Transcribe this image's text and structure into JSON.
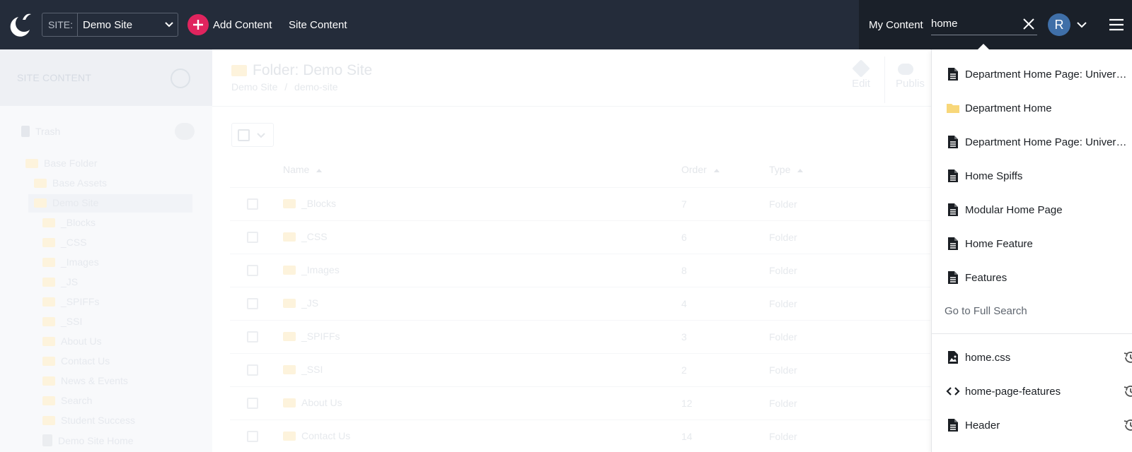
{
  "header": {
    "site_label": "SITE:",
    "site_value": "Demo Site",
    "add_content": "Add Content",
    "site_content": "Site Content",
    "my_content": "My Content",
    "search_value": "home",
    "avatar_initial": "R"
  },
  "sidebar": {
    "title": "SITE CONTENT",
    "trash": "Trash",
    "tree": [
      {
        "label": "Base Folder",
        "kind": "folder"
      },
      {
        "label": "Base Assets",
        "kind": "folder"
      },
      {
        "label": "Demo Site",
        "kind": "folder"
      },
      {
        "label": "_Blocks",
        "kind": "folder"
      },
      {
        "label": "_CSS",
        "kind": "folder"
      },
      {
        "label": "_Images",
        "kind": "folder"
      },
      {
        "label": "_JS",
        "kind": "folder"
      },
      {
        "label": "_SPIFFs",
        "kind": "folder"
      },
      {
        "label": "_SSI",
        "kind": "folder"
      },
      {
        "label": "About Us",
        "kind": "folder"
      },
      {
        "label": "Contact Us",
        "kind": "folder"
      },
      {
        "label": "News & Events",
        "kind": "folder"
      },
      {
        "label": "Search",
        "kind": "folder"
      },
      {
        "label": "Student Success",
        "kind": "folder"
      },
      {
        "label": "Demo Site Home",
        "kind": "page"
      }
    ]
  },
  "main": {
    "title": "Folder: Demo Site",
    "breadcrumb_root": "Demo Site",
    "breadcrumb_sep": "/",
    "breadcrumb_leaf": "demo-site",
    "edit": "Edit",
    "publish": "Publis",
    "columns": {
      "name": "Name",
      "order": "Order",
      "type": "Type"
    },
    "rows": [
      {
        "name": "_Blocks",
        "order": "7",
        "type": "Folder"
      },
      {
        "name": "_CSS",
        "order": "6",
        "type": "Folder"
      },
      {
        "name": "_Images",
        "order": "8",
        "type": "Folder"
      },
      {
        "name": "_JS",
        "order": "4",
        "type": "Folder"
      },
      {
        "name": "_SPIFFs",
        "order": "3",
        "type": "Folder"
      },
      {
        "name": "_SSI",
        "order": "2",
        "type": "Folder"
      },
      {
        "name": "About Us",
        "order": "12",
        "type": "Folder"
      },
      {
        "name": "Contact Us",
        "order": "14",
        "type": "Folder"
      }
    ]
  },
  "dropdown": {
    "results": [
      {
        "label": "Department Home Page: University Name",
        "icon": "page-icon"
      },
      {
        "label": "Department Home",
        "icon": "folder-icon"
      },
      {
        "label": "Department Home Page: University Name",
        "icon": "page-icon"
      },
      {
        "label": "Home Spiffs",
        "icon": "page-icon"
      },
      {
        "label": "Modular Home Page",
        "icon": "page-icon"
      },
      {
        "label": "Home Feature",
        "icon": "page-icon"
      },
      {
        "label": "Features",
        "icon": "page-icon"
      }
    ],
    "full_search": "Go to Full Search",
    "recent": [
      {
        "label": "home.css",
        "icon": "file-image-icon"
      },
      {
        "label": "home-page-features",
        "icon": "code-icon"
      },
      {
        "label": "Header",
        "icon": "page-icon"
      }
    ]
  },
  "colors": {
    "topbar": "#242c3a",
    "topbar_right": "#1a2029",
    "accent": "#e0245e",
    "avatar": "#3f6fa8",
    "folder": "#f8d77a"
  }
}
